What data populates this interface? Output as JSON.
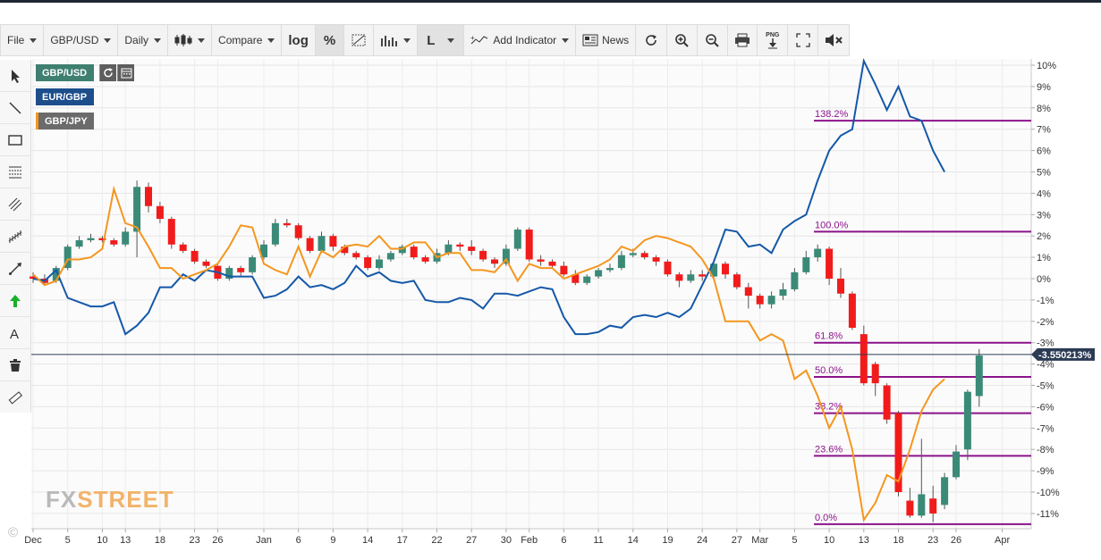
{
  "toolbar": {
    "file": "File",
    "symbol": "GBP/USD",
    "interval": "Daily",
    "compare": "Compare",
    "log": "log",
    "percent": "%",
    "line_type": "L",
    "add_indicator": "Add Indicator",
    "news": "News",
    "png": "PNG"
  },
  "legend": {
    "gbpusd": "GBP/USD",
    "eurgbp": "EUR/GBP",
    "gbpjpy": "GBP/JPY"
  },
  "colors": {
    "up": "#3b8a78",
    "down": "#f21b1b",
    "eurgbp": "#1558a8",
    "gbpjpy": "#f5961f",
    "fib": "#8b138b",
    "current_line": "#2b3b55",
    "legend_gbpusd": "#3e7f70",
    "legend_eurgbp": "#1d4e8c"
  },
  "watermark": {
    "fx": "FX",
    "street": "STREET"
  },
  "copyright": "©",
  "chart_data": {
    "type": "line",
    "title": "",
    "ylim": [
      -11.7,
      10.4
    ],
    "y_ticks": [
      10,
      9,
      8,
      7,
      6,
      5,
      4,
      3,
      2,
      1,
      0,
      -1,
      -2,
      -3,
      -4,
      -5,
      -6,
      -7,
      -8,
      -9,
      -10,
      -11
    ],
    "y_tick_labels": [
      "10%",
      "9%",
      "8%",
      "7%",
      "6%",
      "5%",
      "4%",
      "3%",
      "2%",
      "1%",
      "0%",
      "-1%",
      "-2%",
      "-3%",
      "-4%",
      "-5%",
      "-6%",
      "-7%",
      "-8%",
      "-9%",
      "-10%",
      "-11%"
    ],
    "x_ticks": [
      {
        "label": "Dec",
        "i": 0
      },
      {
        "label": "5",
        "i": 3
      },
      {
        "label": "10",
        "i": 6
      },
      {
        "label": "13",
        "i": 8
      },
      {
        "label": "18",
        "i": 11
      },
      {
        "label": "23",
        "i": 14
      },
      {
        "label": "26",
        "i": 16
      },
      {
        "label": "Jan",
        "i": 20
      },
      {
        "label": "6",
        "i": 23
      },
      {
        "label": "9",
        "i": 26
      },
      {
        "label": "14",
        "i": 29
      },
      {
        "label": "17",
        "i": 32
      },
      {
        "label": "22",
        "i": 35
      },
      {
        "label": "27",
        "i": 38
      },
      {
        "label": "30",
        "i": 41
      },
      {
        "label": "Feb",
        "i": 43
      },
      {
        "label": "6",
        "i": 46
      },
      {
        "label": "11",
        "i": 49
      },
      {
        "label": "14",
        "i": 52
      },
      {
        "label": "19",
        "i": 55
      },
      {
        "label": "24",
        "i": 58
      },
      {
        "label": "27",
        "i": 61
      },
      {
        "label": "Mar",
        "i": 63
      },
      {
        "label": "5",
        "i": 66
      },
      {
        "label": "10",
        "i": 69
      },
      {
        "label": "13",
        "i": 72
      },
      {
        "label": "18",
        "i": 75
      },
      {
        "label": "23",
        "i": 78
      },
      {
        "label": "26",
        "i": 80
      },
      {
        "label": "Apr",
        "i": 84
      }
    ],
    "candles": [
      [
        0.1,
        0.0,
        0.3,
        -0.2
      ],
      [
        0.0,
        -0.2,
        0.2,
        -0.3
      ],
      [
        -0.1,
        0.5,
        0.6,
        -0.2
      ],
      [
        0.5,
        1.5,
        1.6,
        0.4
      ],
      [
        1.5,
        1.8,
        2.0,
        1.4
      ],
      [
        1.8,
        1.9,
        2.1,
        1.7
      ],
      [
        1.9,
        1.8,
        2.0,
        1.7
      ],
      [
        1.8,
        1.6,
        1.9,
        1.5
      ],
      [
        1.6,
        2.2,
        2.4,
        1.5
      ],
      [
        2.2,
        4.3,
        4.6,
        1.0
      ],
      [
        4.3,
        3.4,
        4.5,
        3.1
      ],
      [
        3.4,
        2.8,
        3.6,
        2.6
      ],
      [
        2.8,
        1.6,
        2.9,
        1.4
      ],
      [
        1.6,
        1.3,
        1.7,
        1.2
      ],
      [
        1.3,
        0.8,
        1.4,
        0.7
      ],
      [
        0.8,
        0.6,
        0.9,
        0.5
      ],
      [
        0.6,
        0.0,
        0.7,
        -0.1
      ],
      [
        0.0,
        0.5,
        0.6,
        -0.1
      ],
      [
        0.5,
        0.3,
        0.6,
        0.1
      ],
      [
        0.3,
        1.0,
        1.1,
        0.2
      ],
      [
        1.0,
        1.6,
        1.8,
        0.9
      ],
      [
        1.6,
        2.6,
        2.8,
        1.5
      ],
      [
        2.6,
        2.5,
        2.8,
        2.4
      ],
      [
        2.5,
        1.9,
        2.6,
        1.8
      ],
      [
        1.9,
        1.3,
        2.0,
        1.2
      ],
      [
        1.3,
        2.0,
        2.2,
        1.2
      ],
      [
        2.0,
        1.5,
        2.1,
        1.3
      ],
      [
        1.5,
        1.2,
        1.6,
        1.1
      ],
      [
        1.2,
        1.0,
        1.3,
        0.9
      ],
      [
        1.0,
        0.5,
        1.1,
        0.4
      ],
      [
        0.5,
        0.9,
        1.1,
        0.4
      ],
      [
        0.9,
        1.2,
        1.3,
        0.8
      ],
      [
        1.2,
        1.5,
        1.6,
        1.1
      ],
      [
        1.5,
        1.0,
        1.6,
        0.9
      ],
      [
        1.0,
        0.8,
        1.1,
        0.7
      ],
      [
        0.8,
        1.2,
        1.4,
        0.7
      ],
      [
        1.2,
        1.6,
        1.8,
        1.1
      ],
      [
        1.6,
        1.5,
        1.7,
        1.3
      ],
      [
        1.5,
        1.3,
        1.8,
        1.1
      ],
      [
        1.3,
        0.9,
        1.4,
        0.8
      ],
      [
        0.9,
        0.7,
        1.0,
        0.5
      ],
      [
        0.7,
        1.4,
        1.6,
        0.6
      ],
      [
        1.4,
        2.3,
        2.4,
        1.3
      ],
      [
        2.3,
        0.9,
        2.4,
        0.8
      ],
      [
        0.9,
        0.8,
        1.1,
        0.6
      ],
      [
        0.8,
        0.6,
        0.9,
        0.5
      ],
      [
        0.6,
        0.2,
        0.8,
        0.1
      ],
      [
        0.2,
        -0.2,
        0.4,
        -0.3
      ],
      [
        -0.2,
        0.1,
        0.2,
        -0.3
      ],
      [
        0.1,
        0.4,
        0.5,
        0.0
      ],
      [
        0.4,
        0.5,
        0.7,
        0.3
      ],
      [
        0.5,
        1.1,
        1.3,
        0.4
      ],
      [
        1.1,
        1.2,
        1.4,
        1.0
      ],
      [
        1.2,
        1.0,
        1.3,
        0.9
      ],
      [
        1.0,
        0.8,
        1.1,
        0.6
      ],
      [
        0.8,
        0.2,
        0.9,
        0.1
      ],
      [
        0.2,
        -0.1,
        0.3,
        -0.4
      ],
      [
        -0.1,
        0.2,
        0.4,
        -0.2
      ],
      [
        0.2,
        0.1,
        0.4,
        -0.1
      ],
      [
        0.1,
        0.7,
        0.9,
        0.0
      ],
      [
        0.7,
        0.2,
        0.8,
        0.0
      ],
      [
        0.2,
        -0.4,
        0.3,
        -0.5
      ],
      [
        -0.4,
        -0.8,
        -0.2,
        -1.4
      ],
      [
        -0.8,
        -1.2,
        -0.7,
        -1.4
      ],
      [
        -1.2,
        -0.8,
        -0.6,
        -1.4
      ],
      [
        -0.8,
        -0.5,
        -0.2,
        -1.0
      ],
      [
        -0.5,
        0.3,
        0.5,
        -0.6
      ],
      [
        0.3,
        1.0,
        1.3,
        0.2
      ],
      [
        1.0,
        1.4,
        1.6,
        0.8
      ],
      [
        1.4,
        0.0,
        1.5,
        -0.3
      ],
      [
        0.0,
        -0.7,
        0.5,
        -0.9
      ],
      [
        -0.7,
        -2.3,
        -0.6,
        -2.4
      ],
      [
        -2.6,
        -4.9,
        -2.2,
        -5.0
      ],
      [
        -4.0,
        -4.9,
        -3.9,
        -5.5
      ],
      [
        -5.0,
        -6.6,
        -4.9,
        -6.8
      ],
      [
        -6.3,
        -10.0,
        -6.2,
        -10.2
      ],
      [
        -10.4,
        -11.1,
        -9.8,
        -11.2
      ],
      [
        -11.1,
        -10.1,
        -7.5,
        -11.2
      ],
      [
        -10.3,
        -11.0,
        -9.7,
        -11.4
      ],
      [
        -10.6,
        -9.3,
        -9.1,
        -10.8
      ],
      [
        -9.3,
        -8.1,
        -7.8,
        -9.4
      ],
      [
        -8.0,
        -5.3,
        -5.2,
        -8.5
      ],
      [
        -5.5,
        -3.6,
        -3.3,
        -6.0
      ]
    ],
    "series": [
      {
        "name": "EUR/GBP",
        "values": [
          0.0,
          -0.1,
          0.4,
          -0.9,
          -1.1,
          -1.3,
          -1.3,
          -1.1,
          -2.6,
          -2.2,
          -1.6,
          -0.4,
          -0.4,
          0.2,
          -0.1,
          0.4,
          0.3,
          0.1,
          0.1,
          0.1,
          -0.9,
          -0.8,
          -0.5,
          0.1,
          -0.4,
          -0.3,
          -0.5,
          -0.2,
          0.6,
          0.1,
          0.3,
          -0.1,
          -0.2,
          -0.1,
          -1.0,
          -1.1,
          -1.1,
          -0.9,
          -1.0,
          -1.4,
          -0.7,
          -0.7,
          -0.8,
          -0.6,
          -0.4,
          -0.5,
          -1.8,
          -2.6,
          -2.6,
          -2.5,
          -2.2,
          -2.3,
          -1.8,
          -1.7,
          -1.8,
          -1.6,
          -1.8,
          -1.4,
          -0.3,
          0.8,
          2.3,
          2.2,
          1.5,
          1.6,
          1.2,
          2.3,
          2.7,
          3.0,
          4.6,
          6.0,
          6.7,
          7.0,
          10.2,
          9.1,
          7.9,
          9.0,
          7.6,
          7.4,
          6.0,
          5.0
        ]
      },
      {
        "name": "GBP/JPY",
        "values": [
          0.2,
          -0.3,
          -0.1,
          0.9,
          0.9,
          1.0,
          1.4,
          4.2,
          2.6,
          2.4,
          1.5,
          0.5,
          0.5,
          0.0,
          0.2,
          0.4,
          0.7,
          1.5,
          2.5,
          2.4,
          0.7,
          0.4,
          0.2,
          1.5,
          0.1,
          1.3,
          1.0,
          1.5,
          1.6,
          1.5,
          2.0,
          1.4,
          1.4,
          1.7,
          1.7,
          1.0,
          1.2,
          1.2,
          0.4,
          0.4,
          0.3,
          0.9,
          -0.1,
          0.7,
          0.5,
          0.5,
          0.0,
          0.2,
          0.4,
          0.6,
          0.9,
          1.5,
          1.3,
          1.8,
          2.0,
          1.9,
          1.7,
          1.5,
          0.9,
          0.0,
          -2.0,
          -2.0,
          -2.0,
          -2.9,
          -2.6,
          -2.9,
          -4.7,
          -4.3,
          -5.5,
          -7.0,
          -6.0,
          -8.0,
          -11.3,
          -10.5,
          -9.2,
          -9.5,
          -8.0,
          -6.2,
          -5.2,
          -4.7
        ]
      }
    ],
    "fib_levels": [
      {
        "label": "138.2%",
        "value": 7.4
      },
      {
        "label": "100.0%",
        "value": 2.2
      },
      {
        "label": "61.8%",
        "value": -3.0
      },
      {
        "label": "50.0%",
        "value": -4.6
      },
      {
        "label": "38.2%",
        "value": -6.3
      },
      {
        "label": "23.6%",
        "value": -8.3
      },
      {
        "label": "0.0%",
        "value": -11.5
      }
    ],
    "current_value": -3.55,
    "current_label": "-3.550213%"
  }
}
